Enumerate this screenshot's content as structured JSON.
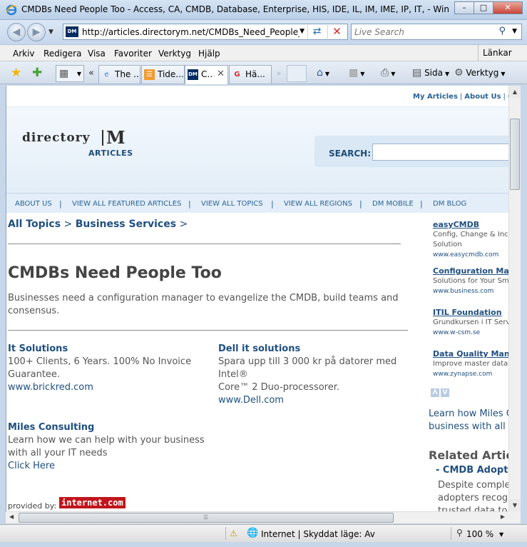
{
  "window": {
    "title": "CMDBs Need People Too - Access, CA, CMDB, Database, Enterprise, HIS, IDE, IL, IM, IME, IP, IT,  - Windows Inter...",
    "minimize": "–",
    "maximize": "□",
    "close": "✕"
  },
  "address": {
    "favicon": "DM",
    "url": "http://articles.directorym.net/CMDBs_Need_People_Too-"
  },
  "search": {
    "placeholder": "Live Search"
  },
  "menu": {
    "items": [
      "Arkiv",
      "Redigera",
      "Visa",
      "Favoriter",
      "Verktyg",
      "Hjälp"
    ],
    "links": "Länkar"
  },
  "tabs": [
    {
      "label": "The ...",
      "icon": "ie-icon"
    },
    {
      "label": "Tide...",
      "icon": "feed-icon"
    },
    {
      "label": "C..",
      "icon": "dm-icon",
      "active": true
    },
    {
      "label": "Hä...",
      "icon": "google-icon"
    }
  ],
  "commands": {
    "page": "Sida",
    "tools": "Verktyg"
  },
  "page": {
    "toplinks": [
      "My Articles",
      "About Us",
      "Co"
    ],
    "logo": {
      "word": "directory",
      "mark": "M",
      "sub": "ARTICLES"
    },
    "search_label": "SEARCH:",
    "nav": [
      "ABOUT US",
      "VIEW ALL FEATURED ARTICLES",
      "VIEW ALL TOPICS",
      "VIEW ALL REGIONS",
      "DM MOBILE",
      "DM BLOG"
    ],
    "breadcrumb": {
      "topic": "All Topics",
      "sep": " > ",
      "sub": "Business Services",
      "end": " >"
    },
    "title": "CMDBs Need People Too",
    "deck": "Businesses need a configuration manager to evangelize the CMDB, build teams and consensus.",
    "ads": [
      {
        "title": "It Solutions",
        "lines": [
          "100+ Clients, 6 Years. 100% No Invoice",
          "Guarantee."
        ],
        "url": "www.brickred.com"
      },
      {
        "title": "Dell it solutions",
        "lines": [
          "Spara upp till 3 000 kr på datorer med Intel®",
          "Core™ 2 Duo-processorer."
        ],
        "url": "www.Dell.com"
      },
      {
        "title": "Miles Consulting",
        "lines": [
          "Learn how we can help with your business",
          "with all your IT needs"
        ],
        "url": "Click Here"
      }
    ],
    "provided_by": "provided by:",
    "internet_logo": "internet.com",
    "sidebar_ads": [
      {
        "title": "easyCMDB",
        "lines": [
          "Config, Change & Incid",
          "Solution"
        ],
        "url": "www.easycmdb.com"
      },
      {
        "title": "Configuration Mana",
        "lines": [
          "Solutions for Your Sm"
        ],
        "url": "www.business.com"
      },
      {
        "title": "ITIL Foundation",
        "lines": [
          "Grundkursen i IT Servi"
        ],
        "url": "www.w-csm.se"
      },
      {
        "title": "Data Quality Manage",
        "lines": [
          "Improve master data q"
        ],
        "url": "www.zynapse.com"
      }
    ],
    "sidebar_arrows": [
      "Λ",
      "V"
    ],
    "learn_more": [
      "Learn how Miles C",
      "business with all y"
    ],
    "related_heading": "Related Articl",
    "related_item": "- CMDB Adoption",
    "related_desc": [
      "Despite comple",
      "adopters recogr",
      "trusted data to"
    ]
  },
  "status": {
    "zone": "Internet | Skyddat läge: Av",
    "zoom": "100 %"
  }
}
